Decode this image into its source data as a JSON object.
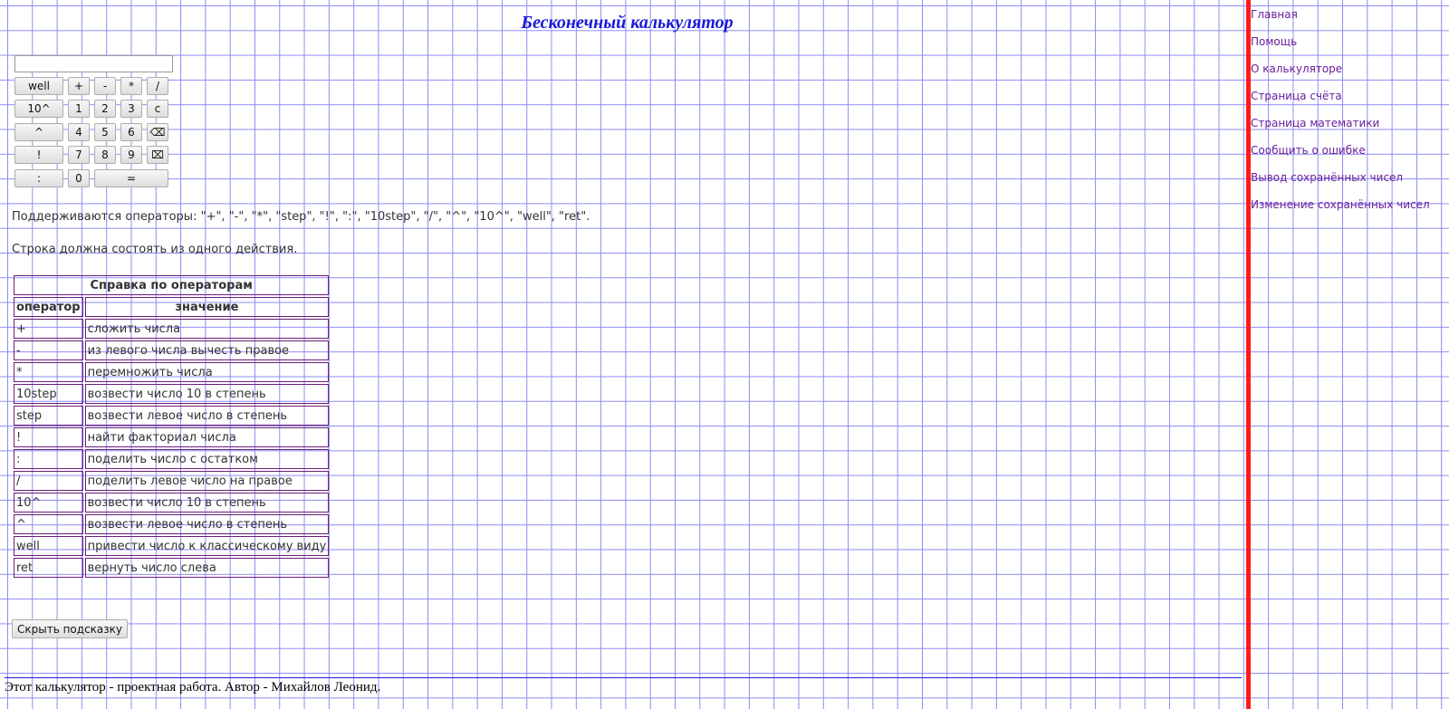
{
  "title": "Бесконечный калькулятор",
  "nav": [
    "Главная",
    "Помощь",
    "О калькуляторе",
    "Страница счёта",
    "Страница математики",
    "Сообщить о ошибке",
    "Вывод сохранённых чисел",
    "Изменение сохранённых чисел"
  ],
  "calculator": {
    "display_value": "",
    "buttons": {
      "well": "well",
      "plus": "+",
      "minus": "-",
      "multiply": "*",
      "divide": "/",
      "pow10": "10^",
      "d1": "1",
      "d2": "2",
      "d3": "3",
      "clear": "c",
      "power": "^",
      "d4": "4",
      "d5": "5",
      "d6": "6",
      "backspace": "⌫",
      "factorial": "!",
      "d7": "7",
      "d8": "8",
      "d9": "9",
      "clear_all": "⌧",
      "remainder": ":",
      "d0": "0",
      "equals": "="
    }
  },
  "info": {
    "operators_text": "Поддерживаются операторы: \"+\", \"-\", \"*\", \"step\", \"!\", \":\", \"10step\", \"/\", \"^\", \"10^\", \"well\", \"ret\".",
    "single_action_text": "Строка должна состоять из одного действия."
  },
  "reference": {
    "caption": "Справка по операторам",
    "headers": [
      "оператор",
      "значение"
    ],
    "rows": [
      [
        "+",
        "сложить числа"
      ],
      [
        "-",
        "из левого числа вычесть правое"
      ],
      [
        "*",
        "перемножить числа"
      ],
      [
        "10step",
        "возвести число 10 в степень"
      ],
      [
        "step",
        "возвести левое число в степень"
      ],
      [
        "!",
        "найти факториал числа"
      ],
      [
        ":",
        "поделить число с остатком"
      ],
      [
        "/",
        "поделить левое число на правое"
      ],
      [
        "10^",
        "возвести число 10 в степень"
      ],
      [
        "^",
        "возвести левое число в степень"
      ],
      [
        "well",
        "привести число к классическому виду"
      ],
      [
        "ret",
        "вернуть число слева"
      ]
    ]
  },
  "hide_button": "Скрыть подсказку",
  "footer": "Этот калькулятор - проектная работа. Автор - Михайлов Леонид.",
  "colors": {
    "grid": "#8c8cf5",
    "margin_line": "#ff1a1a",
    "title": "#1a1ad8",
    "link": "#6a1f9c",
    "table_border": "#6b1e7a"
  }
}
